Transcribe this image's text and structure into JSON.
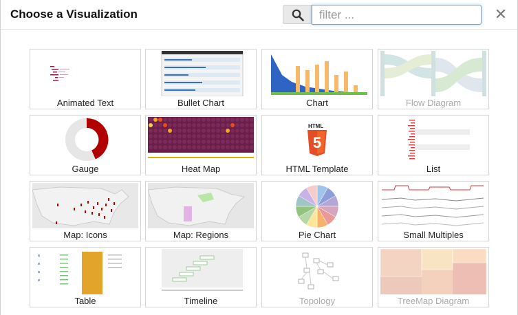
{
  "dialog": {
    "title": "Choose a Visualization",
    "filter_placeholder": "filter ...",
    "close_symbol": "✕"
  },
  "tiles": [
    {
      "label": "Animated Text",
      "enabled": true
    },
    {
      "label": "Bullet Chart",
      "enabled": true
    },
    {
      "label": "Chart",
      "enabled": true
    },
    {
      "label": "Flow Diagram",
      "enabled": false
    },
    {
      "label": "Gauge",
      "enabled": true
    },
    {
      "label": "Heat Map",
      "enabled": true
    },
    {
      "label": "HTML Template",
      "enabled": true
    },
    {
      "label": "List",
      "enabled": true
    },
    {
      "label": "Map: Icons",
      "enabled": true
    },
    {
      "label": "Map: Regions",
      "enabled": true
    },
    {
      "label": "Pie Chart",
      "enabled": true
    },
    {
      "label": "Small Multiples",
      "enabled": true
    },
    {
      "label": "Table",
      "enabled": true
    },
    {
      "label": "Timeline",
      "enabled": true
    },
    {
      "label": "Topology",
      "enabled": false
    },
    {
      "label": "TreeMap Diagram",
      "enabled": false
    }
  ],
  "html_badge": {
    "text": "HTML",
    "number": "5"
  }
}
